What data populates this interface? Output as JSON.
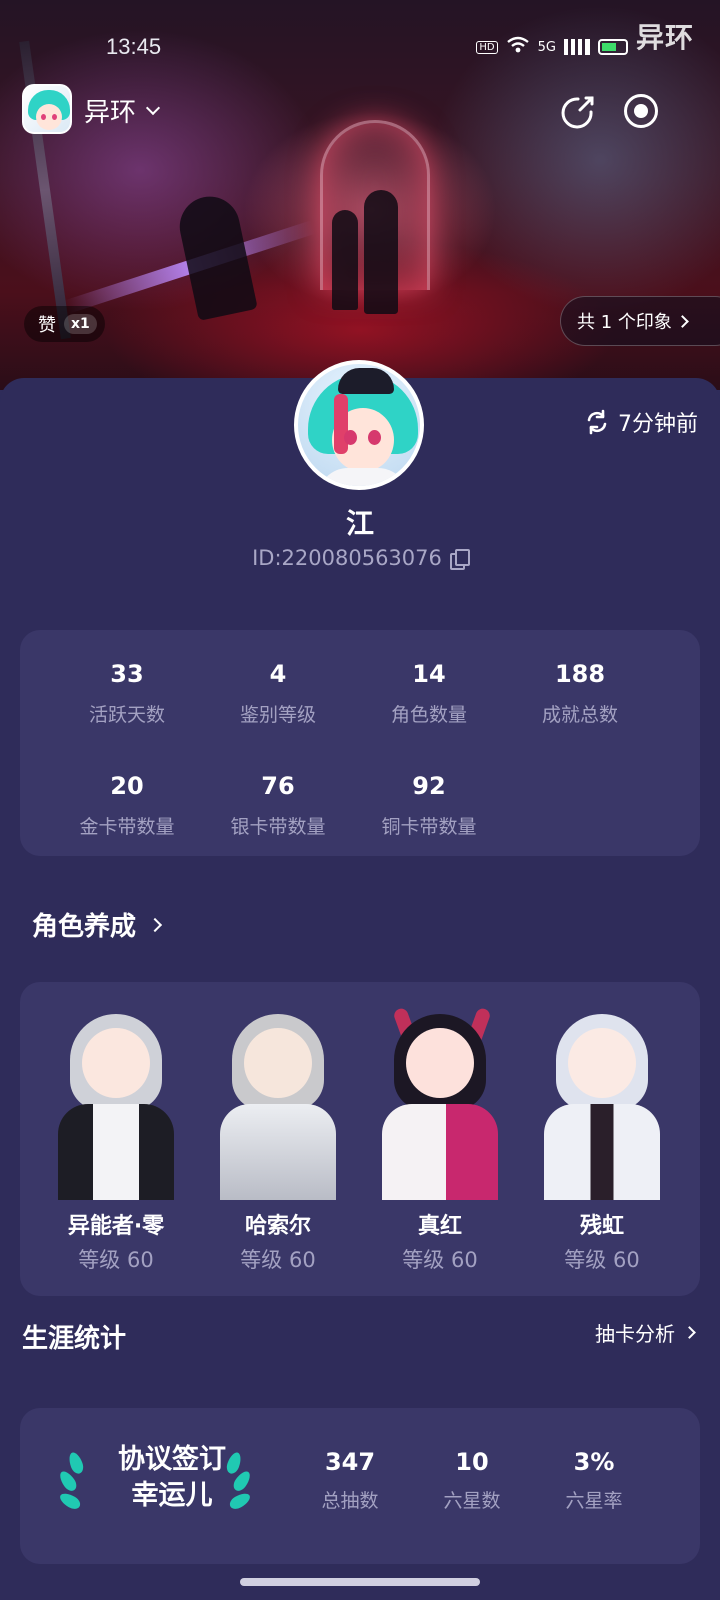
{
  "status_bar": {
    "time": "13:45",
    "hd": "HD",
    "net": "5G",
    "battery": "65"
  },
  "watermark": "异环",
  "header": {
    "app_name": "异环"
  },
  "hero": {
    "like_label": "赞",
    "like_count": "x1",
    "impressions": "共 1 个印象"
  },
  "profile": {
    "nickname": "江",
    "id_text": "ID:220080563076",
    "refresh_text": "7分钟前"
  },
  "stats": [
    {
      "value": "33",
      "label": "活跃天数"
    },
    {
      "value": "4",
      "label": "鉴别等级"
    },
    {
      "value": "14",
      "label": "角色数量"
    },
    {
      "value": "188",
      "label": "成就总数"
    },
    {
      "value": "20",
      "label": "金卡带数量"
    },
    {
      "value": "76",
      "label": "银卡带数量"
    },
    {
      "value": "92",
      "label": "铜卡带数量"
    }
  ],
  "roles_section": {
    "title": "角色养成",
    "roles": [
      {
        "name": "异能者·零",
        "level": "等级 60"
      },
      {
        "name": "哈索尔",
        "level": "等级 60"
      },
      {
        "name": "真红",
        "level": "等级 60"
      },
      {
        "name": "残虹",
        "level": "等级 60"
      }
    ]
  },
  "career_section": {
    "title": "生涯统计",
    "link": "抽卡分析",
    "badge_line1": "协议签订",
    "badge_line2": "幸运儿",
    "stats": [
      {
        "value": "347",
        "label": "总抽数"
      },
      {
        "value": "10",
        "label": "六星数"
      },
      {
        "value": "3%",
        "label": "六星率"
      }
    ]
  }
}
